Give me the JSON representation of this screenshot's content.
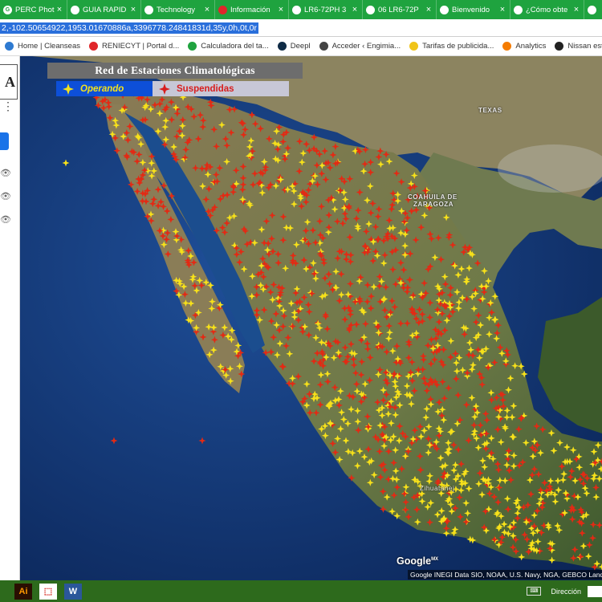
{
  "tabs": [
    {
      "label": "PERC Photo",
      "favicon": "G"
    },
    {
      "label": "GUIA RAPID",
      "favicon": "globe"
    },
    {
      "label": "Technology",
      "favicon": "globe"
    },
    {
      "label": "Información",
      "favicon": "red-dot"
    },
    {
      "label": "LR6-72PH 3",
      "favicon": "globe"
    },
    {
      "label": "06 LR6-72P",
      "favicon": "globe"
    },
    {
      "label": "Bienvenido",
      "favicon": "power"
    },
    {
      "label": "¿Cómo obte",
      "favicon": "plane"
    },
    {
      "label": "",
      "favicon": "globe"
    }
  ],
  "address": {
    "url": "2,-102.50654922,1953.01670886a,3396778.24841831d,35y,0h,0t,0r"
  },
  "bookmarks": [
    {
      "label": "Home | Cleanseas",
      "icon_color": "#2e7ad1"
    },
    {
      "label": "RENIECYT | Portal d...",
      "icon_color": "#e0262a"
    },
    {
      "label": "Calculadora del ta...",
      "icon_color": "#1fa33f"
    },
    {
      "label": "Deepl",
      "icon_color": "#0f2b46"
    },
    {
      "label": "Acceder ‹ Engimia...",
      "icon_color": "#444444"
    },
    {
      "label": "Tarifas de publicida...",
      "icon_color": "#f0c419"
    },
    {
      "label": "Analytics",
      "icon_color": "#f57c00"
    },
    {
      "label": "Nissan estrena sus t...",
      "icon_color": "#222222"
    }
  ],
  "legend": {
    "title": "Red de Estaciones Climatológicas",
    "operating": "Operando",
    "suspended": "Suspendidas"
  },
  "map_labels": {
    "texas": "TEXAS",
    "coahuila": "COAHUILA DE",
    "coahuila2": "ZARAGOZA",
    "zihuatanejo": "Zihuatanej"
  },
  "google": {
    "logo": "Google",
    "attribution": "Google INEGI Data SIO, NOAA, U.S. Navy, NGA, GEBCO Land"
  },
  "taskbar": {
    "apps": [
      "Ai",
      "PDF",
      "W"
    ],
    "right_label": "Dirección"
  },
  "colors": {
    "operating": "#f7e11a",
    "suspended": "#e32a14",
    "ocean": "#133a78",
    "land": "#7a6a45"
  }
}
